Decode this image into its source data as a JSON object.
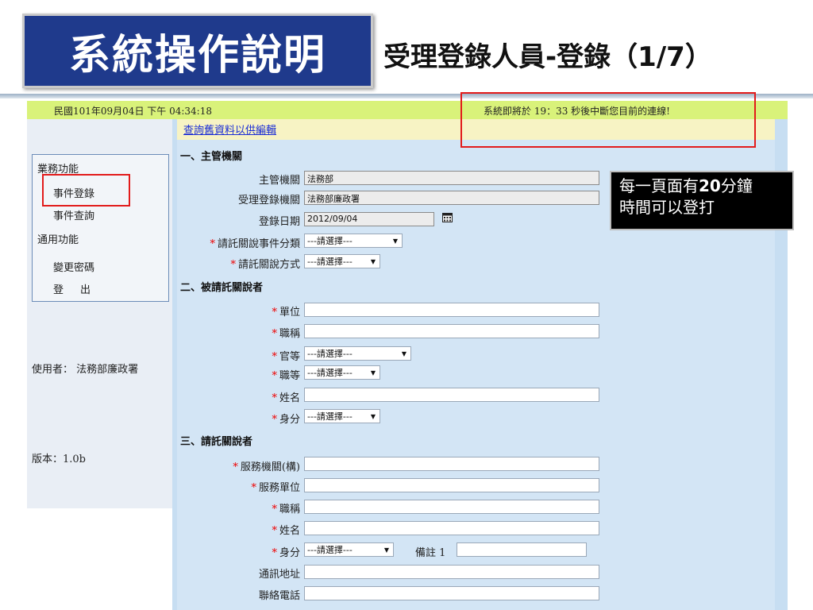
{
  "slide": {
    "title": "系統操作說明",
    "subtitle": "受理登錄人員-登錄（1/7）"
  },
  "topbar": {
    "datetime": "民國101年09月04日 下午 04:34:18",
    "timeout_warning": "系統即將於 19：33 秒後中斷您目前的連線!"
  },
  "linkbar": {
    "query_link": "查詢舊資料以供編輯"
  },
  "sidebar": {
    "group1": "業務功能",
    "item_register": "事件登錄",
    "item_query": "事件查詢",
    "group2": "通用功能",
    "item_change_password": "變更密碼",
    "item_logout": "登　出",
    "user": "使用者： 法務部廉政署",
    "version": "版本：1.0b"
  },
  "form": {
    "section1": "一、主管機關",
    "agency_label": "主管機關",
    "agency_value": "法務部",
    "receiving_agency_label": "受理登錄機關",
    "receiving_agency_value": "法務部廉政署",
    "register_date_label": "登錄日期",
    "register_date_value": "2012/09/04",
    "category_label": "請託關說事件分類",
    "category_value": "---請選擇---",
    "method_label": "請託關說方式",
    "method_value": "---請選擇---",
    "section2": "二、被請託關說者",
    "s2_unit_label": "單位",
    "s2_title_label": "職稱",
    "s2_rank_label": "官等",
    "s2_rank_value": "---請選擇---",
    "s2_grade_label": "職等",
    "s2_grade_value": "---請選擇---",
    "s2_name_label": "姓名",
    "s2_identity_label": "身分",
    "s2_identity_value": "---請選擇---",
    "section3": "三、請託關說者",
    "s3_org_label": "服務機關(構)",
    "s3_unit_label": "服務單位",
    "s3_title_label": "職稱",
    "s3_name_label": "姓名",
    "s3_identity_label": "身分",
    "s3_identity_value": "---請選擇---",
    "s3_note_label": "備註 1",
    "address_label": "通訊地址",
    "phone_label": "聯絡電話",
    "required_mark": "*"
  },
  "callout": {
    "line1_pre": "每一頁面有",
    "line1_bold": "20",
    "line1_post": "分鐘",
    "line2": "時間可以登打"
  },
  "colors": {
    "title_bg": "#1f3a8c",
    "topbar_bg": "#d9f27a",
    "highlight_red": "#e21b1b",
    "form_bg": "#d3e5f5"
  }
}
